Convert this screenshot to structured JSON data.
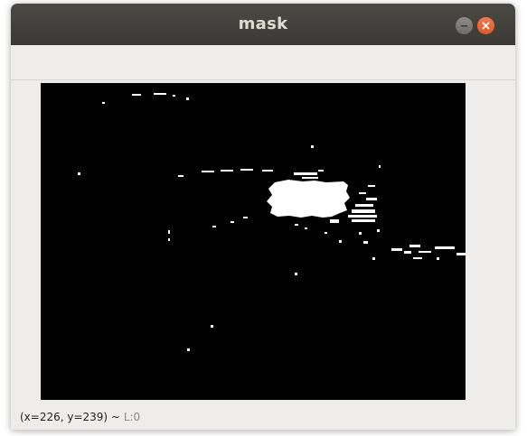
{
  "window": {
    "title": "mask"
  },
  "icons": {
    "minimize": "minimize-icon",
    "close": "close-icon"
  },
  "status": {
    "coords": "(x=226, y=239) ~",
    "level": "L:0"
  },
  "colors": {
    "titlebar": "#3f3e3a",
    "title_text": "#dfdbd2",
    "close_button": "#e95420",
    "minimize_button": "#7a7873",
    "window_bg": "#efedea",
    "mask_background": "#000000",
    "mask_foreground": "#ffffff"
  }
}
